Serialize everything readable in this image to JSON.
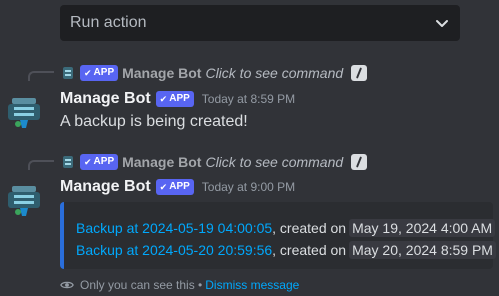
{
  "run_action": {
    "placeholder": "Run action",
    "icon": "chevron-down-icon"
  },
  "messages": [
    {
      "reply": {
        "badge": "APP",
        "name": "Manage Bot",
        "command_hint": "Click to see command"
      },
      "author": "Manage Bot",
      "badge": "APP",
      "timestamp": "Today at 8:59 PM",
      "text": "A backup is being created!"
    },
    {
      "reply": {
        "badge": "APP",
        "name": "Manage Bot",
        "command_hint": "Click to see command"
      },
      "author": "Manage Bot",
      "badge": "APP",
      "timestamp": "Today at 9:00 PM",
      "embed": {
        "rows": [
          {
            "link": "Backup at 2024-05-19 04:00:05",
            "created_text": ", created on",
            "date": "May 19, 2024 4:00 AM"
          },
          {
            "link": "Backup at 2024-05-20 20:59:56",
            "created_text": ", created on",
            "date": "May 20, 2024 8:59 PM"
          }
        ],
        "accent_color": "#2a6edb"
      },
      "ephemeral": {
        "note": "Only you can see this •",
        "dismiss": "Dismiss message"
      }
    }
  ],
  "colors": {
    "background": "#313338",
    "blurple": "#5865f2",
    "link": "#00a8fc"
  }
}
